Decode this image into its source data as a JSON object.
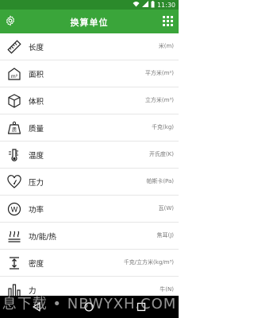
{
  "status_bar": {
    "time": "11:30",
    "icons": [
      "wifi-icon",
      "signal-icon",
      "battery-icon"
    ]
  },
  "header": {
    "title": "换算单位",
    "left_icon": "settings-icon",
    "right_icon": "grid-icon"
  },
  "items": [
    {
      "label": "长度",
      "unit": "米(m)",
      "icon": "ruler-icon"
    },
    {
      "label": "面积",
      "unit": "平方米(m²)",
      "icon": "area-icon"
    },
    {
      "label": "体积",
      "unit": "立方米(m³)",
      "icon": "cube-icon"
    },
    {
      "label": "质量",
      "unit": "千克(kg)",
      "icon": "weight-icon"
    },
    {
      "label": "温度",
      "unit": "开氏度(K)",
      "icon": "thermometer-icon"
    },
    {
      "label": "压力",
      "unit": "帕斯卡(Pa)",
      "icon": "pressure-icon"
    },
    {
      "label": "功率",
      "unit": "瓦(W)",
      "icon": "power-icon"
    },
    {
      "label": "功/能/热",
      "unit": "焦耳(J)",
      "icon": "heat-icon"
    },
    {
      "label": "密度",
      "unit": "千克/立方米(kg/m³)",
      "icon": "density-icon"
    },
    {
      "label": "力",
      "unit": "牛(N)",
      "icon": "force-icon"
    }
  ],
  "watermark": "息下载 • NBWYXH.COM"
}
